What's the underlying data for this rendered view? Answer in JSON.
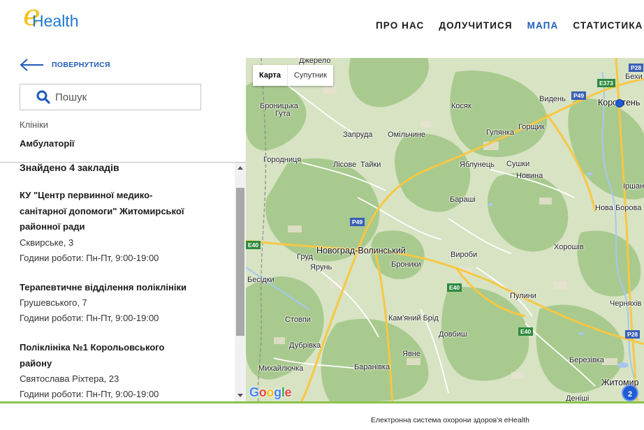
{
  "header": {
    "logo_e": "e",
    "logo_text": "Health",
    "nav": [
      {
        "label": "ПРО НАС",
        "active": false
      },
      {
        "label": "ДОЛУЧИТИСЯ",
        "active": false
      },
      {
        "label": "МАПА",
        "active": true
      },
      {
        "label": "СТАТИСТИКА",
        "active": false
      }
    ]
  },
  "sidebar": {
    "back_label": "ПОВЕРНУТИСЯ",
    "search_placeholder": "Пошук",
    "category_label": "Клініки",
    "category_value": "Амбулаторії",
    "found_text": "Знайдено 4 закладів",
    "facilities": [
      {
        "name": "КУ \"Центр первинної медико-санітарної допомоги\" Житомирської районної ради",
        "address": "Сквирське, 3",
        "hours": "Години роботи: Пн-Пт, 9:00-19:00"
      },
      {
        "name": "Терапевтичне відділення поліклініки",
        "address": "Грушевського, 7",
        "hours": "Години роботи: Пн-Пт, 9:00-19:00"
      },
      {
        "name": "Поліклініка №1 Корольовського району",
        "address": "Святослава Ріхтера, 23",
        "hours": "Години роботи: Пн-Пт, 9:00-19:00"
      }
    ]
  },
  "map": {
    "type_map": "Карта",
    "type_satellite": "Супутник",
    "cluster_count": "2",
    "places": [
      {
        "name": "Джерело",
        "big": false
      },
      {
        "name": "Броницька",
        "big": false
      },
      {
        "name": "Гута",
        "big": false
      },
      {
        "name": "Косяк",
        "big": false
      },
      {
        "name": "Видень",
        "big": false
      },
      {
        "name": "Коростень",
        "big": true
      },
      {
        "name": "Бехи",
        "big": false
      },
      {
        "name": "Запруда",
        "big": false
      },
      {
        "name": "Омільчине",
        "big": false
      },
      {
        "name": "Гулянка",
        "big": false
      },
      {
        "name": "Горщик",
        "big": false
      },
      {
        "name": "Городниця",
        "big": false
      },
      {
        "name": "Лісове",
        "big": false
      },
      {
        "name": "Тайки",
        "big": false
      },
      {
        "name": "Яблунець",
        "big": false
      },
      {
        "name": "Сушки",
        "big": false
      },
      {
        "name": "Новина",
        "big": false
      },
      {
        "name": "Іршан",
        "big": false
      },
      {
        "name": "Бараші",
        "big": false
      },
      {
        "name": "Нова Борова",
        "big": false
      },
      {
        "name": "Новоград-Волинський",
        "big": true
      },
      {
        "name": "Груд",
        "big": false
      },
      {
        "name": "Ярунь",
        "big": false
      },
      {
        "name": "Броники",
        "big": false
      },
      {
        "name": "Вироби",
        "big": false
      },
      {
        "name": "Хорошів",
        "big": false
      },
      {
        "name": "Бесідки",
        "big": false
      },
      {
        "name": "Пулини",
        "big": false
      },
      {
        "name": "Черняхів",
        "big": false
      },
      {
        "name": "Стовпи",
        "big": false
      },
      {
        "name": "Кам'яний Брід",
        "big": false
      },
      {
        "name": "Довбиш",
        "big": false
      },
      {
        "name": "Дубрівка",
        "big": false
      },
      {
        "name": "Явне",
        "big": false
      },
      {
        "name": "Березівка",
        "big": false
      },
      {
        "name": "Михайлючка",
        "big": false
      },
      {
        "name": "Баранівка",
        "big": false
      },
      {
        "name": "Житомир",
        "big": true
      },
      {
        "name": "Деніші",
        "big": false
      }
    ],
    "shields": [
      {
        "label": "P28",
        "color": "blue"
      },
      {
        "label": "E373",
        "color": "green"
      },
      {
        "label": "P49",
        "color": "blue"
      },
      {
        "label": "P49",
        "color": "blue"
      },
      {
        "label": "E40",
        "color": "green"
      },
      {
        "label": "E40",
        "color": "green"
      },
      {
        "label": "E40",
        "color": "green"
      },
      {
        "label": "P28",
        "color": "blue"
      }
    ],
    "colors": {
      "land": "#d7e3c3",
      "forest": "#a8ca8e",
      "road_major": "#f7c745",
      "road_minor": "#ffffff",
      "water": "#a7c7f0",
      "marker": "#1f5bd6"
    }
  },
  "footer": {
    "text": "Електронна система охорони здоров'я eHealth",
    "line_color": "#8bc34a"
  }
}
